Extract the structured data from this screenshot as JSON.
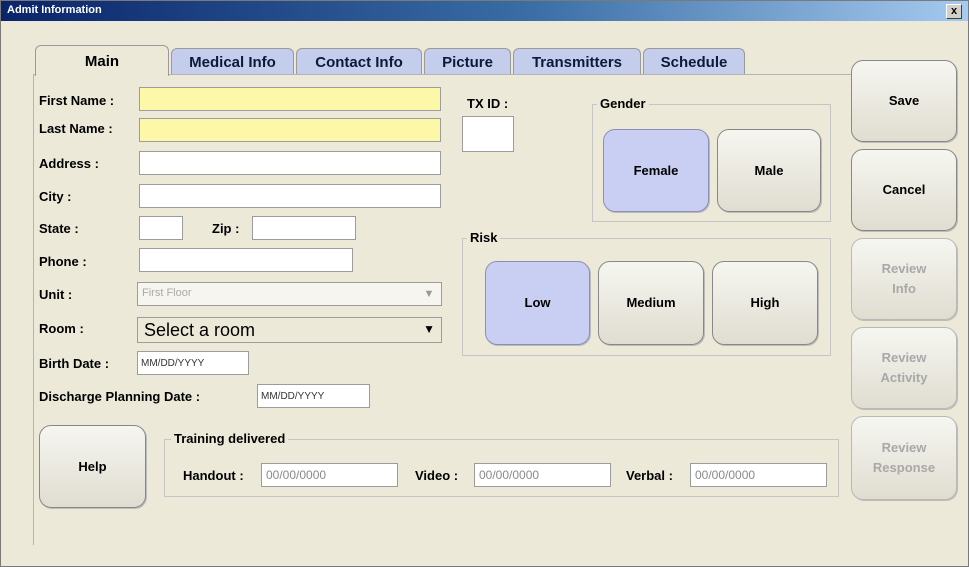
{
  "window": {
    "title": "Admit Information",
    "close_label": "x"
  },
  "tabs": [
    {
      "label": "Main"
    },
    {
      "label": "Medical Info"
    },
    {
      "label": "Contact Info"
    },
    {
      "label": "Picture"
    },
    {
      "label": "Transmitters"
    },
    {
      "label": "Schedule"
    }
  ],
  "form": {
    "first_name_label": "First Name :",
    "last_name_label": "Last Name :",
    "address_label": "Address :",
    "city_label": "City :",
    "state_label": "State :",
    "zip_label": "Zip :",
    "phone_label": "Phone :",
    "unit_label": "Unit :",
    "unit_value": "First Floor",
    "room_label": "Room :",
    "room_value": "Select a room",
    "birth_date_label": "Birth Date :",
    "birth_date_value": "MM/DD/YYYY",
    "discharge_label": "Discharge Planning Date :",
    "discharge_value": "MM/DD/YYYY",
    "txid_label": "TX ID :"
  },
  "gender": {
    "label": "Gender",
    "female": "Female",
    "male": "Male",
    "selected": "Female"
  },
  "risk": {
    "label": "Risk",
    "low": "Low",
    "medium": "Medium",
    "high": "High",
    "selected": "Low"
  },
  "training": {
    "label": "Training delivered",
    "handout_label": "Handout :",
    "handout_value": "00/00/0000",
    "video_label": "Video :",
    "video_value": "00/00/0000",
    "verbal_label": "Verbal :",
    "verbal_value": "00/00/0000"
  },
  "buttons": {
    "help": "Help",
    "save": "Save",
    "cancel": "Cancel",
    "review_info_1": "Review",
    "review_info_2": "Info",
    "review_activity_1": "Review",
    "review_activity_2": "Activity",
    "review_response_1": "Review",
    "review_response_2": "Response"
  },
  "colors": {
    "accent_selected": "#c9cff3",
    "required_field": "#fdf7a8",
    "tab_inactive": "#c5cdec"
  }
}
